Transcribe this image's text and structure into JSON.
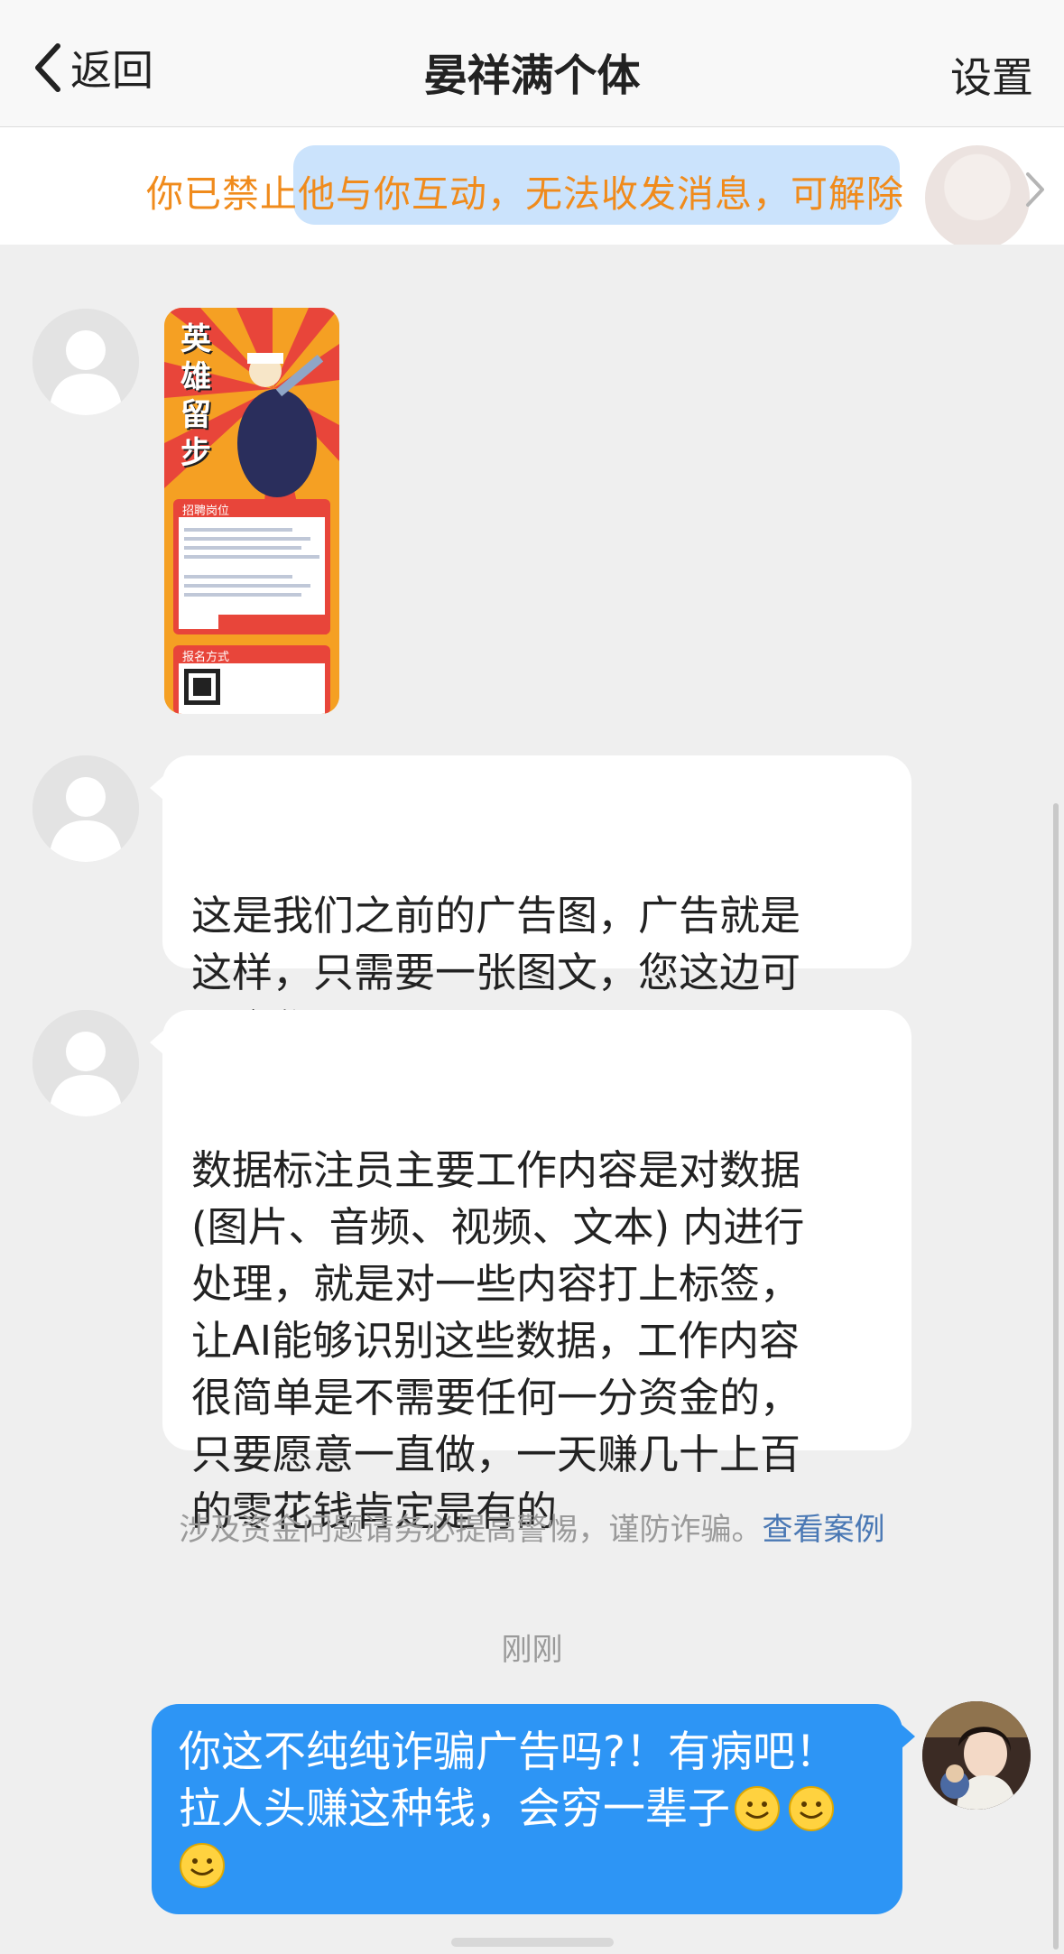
{
  "header": {
    "back_label": "返回",
    "title": "晏祥满个体",
    "settings_label": "设置"
  },
  "banner": {
    "text": "你已禁止他与你互动，无法收发消息，可解除"
  },
  "ad_image": {
    "headline_chars": [
      "英",
      "雄",
      "留",
      "步"
    ],
    "section1_title": "招聘岗位",
    "section2_title": "报名方式"
  },
  "messages": [
    {
      "text": "这是我们之前的广告图，广告就是\n这样，只需要一张图文，您这边可\n以合作吗"
    },
    {
      "text": "数据标注员主要工作内容是对数据\n(图片、音频、视频、文本) 内进行\n处理，就是对一些内容打上标签，\n让AI能够识别这些数据，工作内容\n很简单是不需要任何一分资金的，\n只要愿意一直做，一天赚几十上百\n的零花钱肯定是有的"
    }
  ],
  "notice": {
    "text": "涉及资金问题请务必提高警惕，谨防诈骗。",
    "link": "查看案例"
  },
  "timestamp": "刚刚",
  "my_message": {
    "line1": "你这不纯纯诈骗广告吗?！有病吧！",
    "line2": "拉人头赚这种钱，会穷一辈子"
  },
  "colors": {
    "banner_text": "#f08b1c",
    "my_bubble": "#2d95f5",
    "link": "#4a78b4"
  }
}
